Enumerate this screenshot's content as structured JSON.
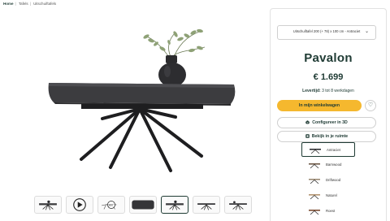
{
  "breadcrumb": [
    "Home",
    "Tafels",
    "Uitschuiftafels"
  ],
  "gallery": {
    "thumbnails": [
      {
        "kind": "photo"
      },
      {
        "kind": "video"
      },
      {
        "kind": "360",
        "label": "360°"
      },
      {
        "kind": "top-view"
      },
      {
        "kind": "photo",
        "active": true
      },
      {
        "kind": "photo"
      },
      {
        "kind": "photo"
      }
    ]
  },
  "product": {
    "size_option": "Uitschuiftafel 200 (+ 78) x 100 cm - Antraciet",
    "name": "Pavalon",
    "price": "€ 1.699",
    "delivery_label": "Levertijd:",
    "delivery_value": "3 tot 8 werkdagen",
    "add_to_cart_label": "In mijn winkelwagen",
    "configure_3d_label": "Configureer in 3D",
    "view_in_room_label": "Bekijk in je ruimte"
  },
  "colors": [
    {
      "name": "Antraciet",
      "selected": true,
      "hex": "#2f3033"
    },
    {
      "name": "Barnwood",
      "hex": "#6e5a48"
    },
    {
      "name": "Driftwood",
      "hex": "#9b8a74"
    },
    {
      "name": "Naturel",
      "hex": "#b39470"
    },
    {
      "name": "Roest",
      "hex": "#7a4a30"
    }
  ],
  "theme": {
    "primary": "#1f3b34",
    "accent": "#f5b82e",
    "table_top": "#3c3c3f",
    "frame": "#1e1e20"
  }
}
